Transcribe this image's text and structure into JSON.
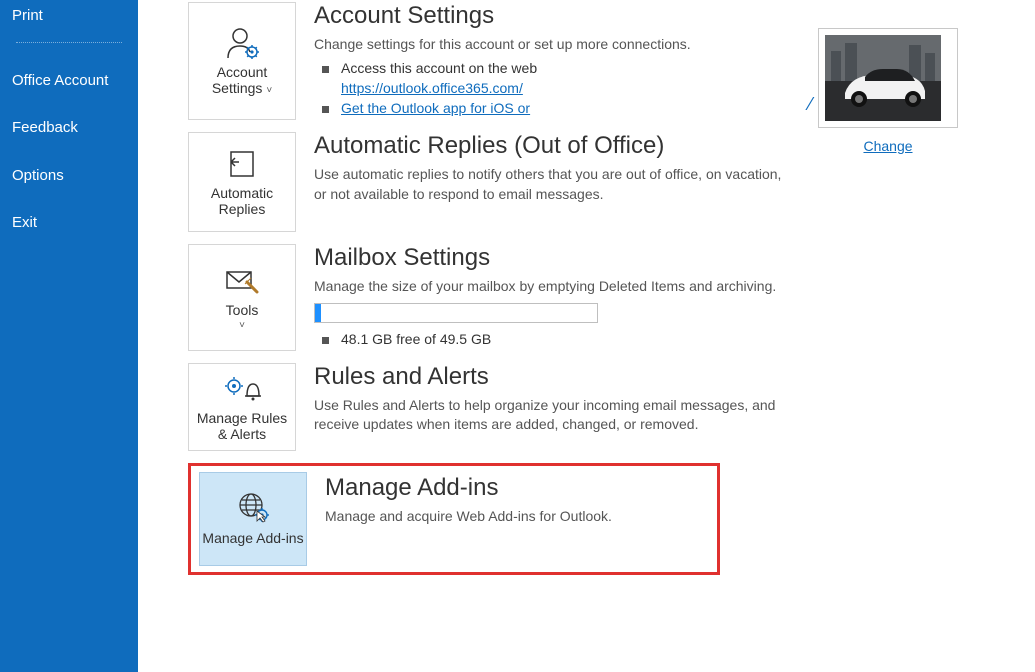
{
  "sidebar": {
    "items": [
      {
        "label": "Print"
      },
      {
        "label": "Office Account"
      },
      {
        "label": "Feedback"
      },
      {
        "label": "Options"
      },
      {
        "label": "Exit"
      }
    ]
  },
  "account": {
    "tile_label": "Account Settings",
    "chevron": "˅",
    "title": "Account Settings",
    "desc": "Change settings for this account or set up more connections.",
    "bullet1_text": "Access this account on the web",
    "bullet1_link": "https://outlook.office365.com/",
    "bullet2_link": "Get the Outlook app for iOS or",
    "change_link": "Change",
    "dash": "⁄"
  },
  "auto": {
    "tile_label": "Automatic Replies",
    "title": "Automatic Replies (Out of Office)",
    "desc": "Use automatic replies to notify others that you are out of office, on vacation, or not available to respond to email messages."
  },
  "mailbox": {
    "tile_label": "Tools",
    "chevron": "˅",
    "title": "Mailbox Settings",
    "desc": "Manage the size of your mailbox by emptying Deleted Items and archiving.",
    "free_text": "48.1 GB free of 49.5 GB"
  },
  "rules": {
    "tile_label": "Manage Rules & Alerts",
    "title": "Rules and Alerts",
    "desc": "Use Rules and Alerts to help organize your incoming email messages, and receive updates when items are added, changed, or removed."
  },
  "addins": {
    "tile_label": "Manage Add-ins",
    "title": "Manage Add-ins",
    "desc": "Manage and acquire Web Add-ins for Outlook."
  }
}
